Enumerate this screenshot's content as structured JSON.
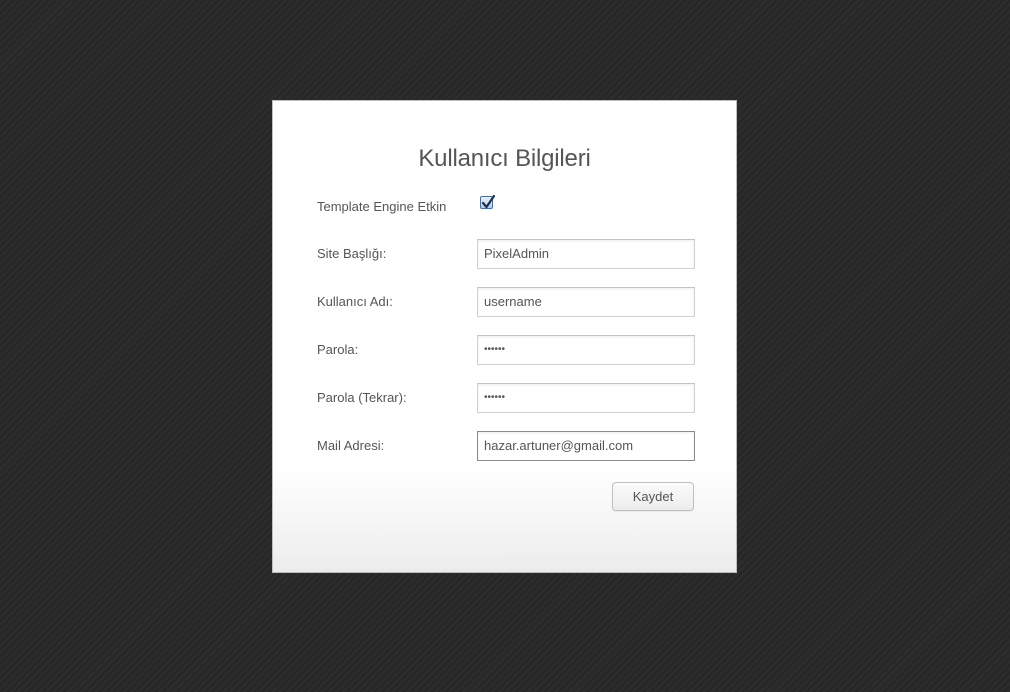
{
  "form": {
    "title": "Kullanıcı Bilgileri",
    "template_engine": {
      "label": "Template Engine Etkin",
      "checked": true
    },
    "site_title": {
      "label": "Site Başlığı:",
      "value": "PixelAdmin"
    },
    "username": {
      "label": "Kullanıcı Adı:",
      "value": "username"
    },
    "password": {
      "label": "Parola:",
      "value": "••••••"
    },
    "password_repeat": {
      "label": "Parola (Tekrar):",
      "value": "••••••"
    },
    "email": {
      "label": "Mail Adresi:",
      "value": "hazar.artuner@gmail.com"
    },
    "save_label": "Kaydet"
  }
}
